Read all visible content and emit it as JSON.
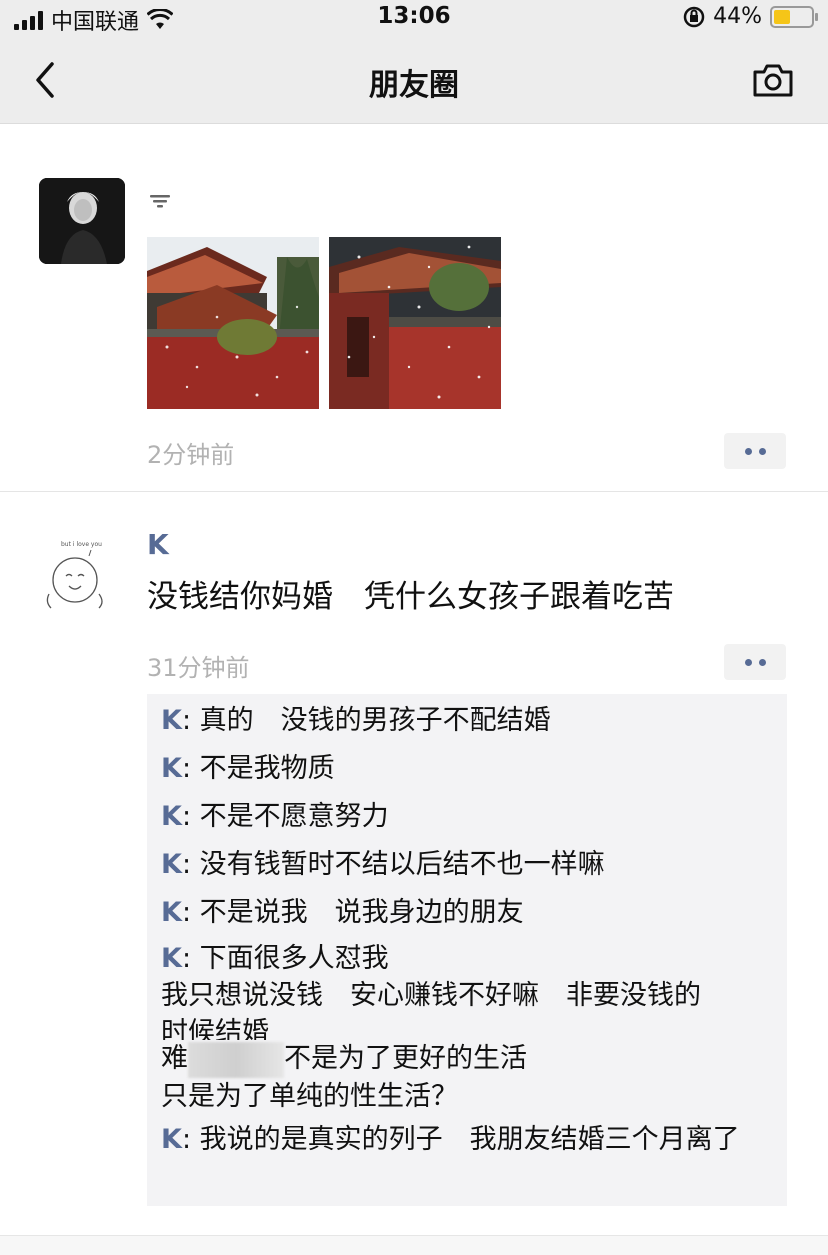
{
  "status_bar": {
    "carrier": "中国联通",
    "time": "13:06",
    "battery_percent": "44%",
    "battery_level": 0.44,
    "battery_color": "#f5c518"
  },
  "nav": {
    "title": "朋友圈",
    "back_icon": "chevron-left-icon",
    "camera_icon": "camera-icon"
  },
  "posts": [
    {
      "author": "",
      "text": "",
      "photos": [
        "temple-snow-photo-1",
        "temple-snow-photo-2"
      ],
      "time": "2分钟前"
    },
    {
      "author": "K",
      "text": "没钱结你妈婚　凭什么女孩子跟着吃苦",
      "time": "31分钟前",
      "comments": [
        {
          "name": "K",
          "text": "真的　没钱的男孩子不配结婚"
        },
        {
          "name": "K",
          "text": "不是我物质"
        },
        {
          "name": "K",
          "text": "不是不愿意努力"
        },
        {
          "name": "K",
          "text": "没有钱暂时不结以后结不也一样嘛"
        },
        {
          "name": "K",
          "text": "不是说我　说我身边的朋友"
        },
        {
          "name": "K",
          "text": "下面很多人怼我",
          "extra_lines": [
            "我只想说没钱　安心赚钱不好嘛　非要没钱的",
            "时候结婚",
            "难",
            "不是为了更好的生活",
            "只是为了单纯的性生活？"
          ]
        },
        {
          "name": "K",
          "text": "我说的是真实的列子　我朋友结婚三个月离了"
        }
      ]
    }
  ],
  "accent_color": "#576b95"
}
